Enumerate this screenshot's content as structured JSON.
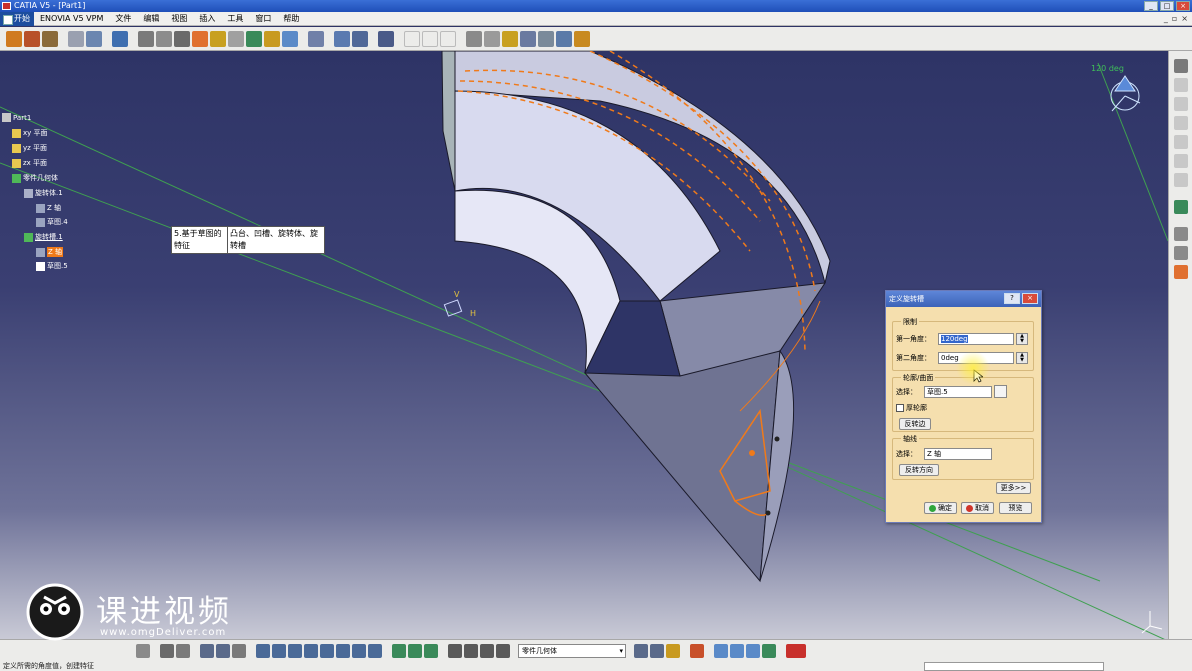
{
  "window": {
    "title": "CATIA V5 - [Part1]"
  },
  "menu": {
    "start": "开始",
    "items": [
      "ENOVIA V5 VPM",
      "文件",
      "编辑",
      "视图",
      "插入",
      "工具",
      "窗口",
      "帮助"
    ]
  },
  "tree": {
    "root": "Part1",
    "xy": "xy 平面",
    "yz": "yz 平面",
    "zx": "zx 平面",
    "body": "零件几何体",
    "shaft1": "旋转体.1",
    "axis1": "Z 轴",
    "sketch4": "草图.4",
    "groove1": "旋转槽.1",
    "axis_sel": "Z 轴",
    "sketch5": "草图.5"
  },
  "tooltip": {
    "left": "5.基于草图的特征",
    "right": "凸台、凹槽、旋转体、旋转槽"
  },
  "dialog": {
    "title": "定义旋转槽",
    "help": "?",
    "limits_label": "限制",
    "first_angle_label": "第一角度：",
    "first_angle_value": "120deg",
    "second_angle_label": "第二角度：",
    "second_angle_value": "0deg",
    "profile_label": "轮廓/曲面",
    "select_label": "选择：",
    "profile_value": "草图.5",
    "thick_label": "厚轮廓",
    "reverse_side": "反转边",
    "axis_label": "轴线",
    "axis_select_label": "选择：",
    "axis_value": "Z 轴",
    "reverse_dir": "反转方向",
    "more": "更多>>",
    "ok": "确定",
    "cancel": "取消",
    "preview": "预览"
  },
  "viewport": {
    "compass_angle": "120 deg",
    "sketch_labels": {
      "v": "V",
      "h": "H"
    }
  },
  "combo": {
    "value": "零件几何体"
  },
  "status": {
    "text": "定义所需的角度值，创建特征"
  },
  "watermark": {
    "title": "课进视频",
    "url": "www.omgDeliver.com"
  },
  "colors": {
    "background_top": "#2e3466",
    "dialog": "#f5dfae",
    "sketch_orange": "#f07a1a",
    "axis_green": "#3fbf5a",
    "solid_face": "#d8daef"
  }
}
